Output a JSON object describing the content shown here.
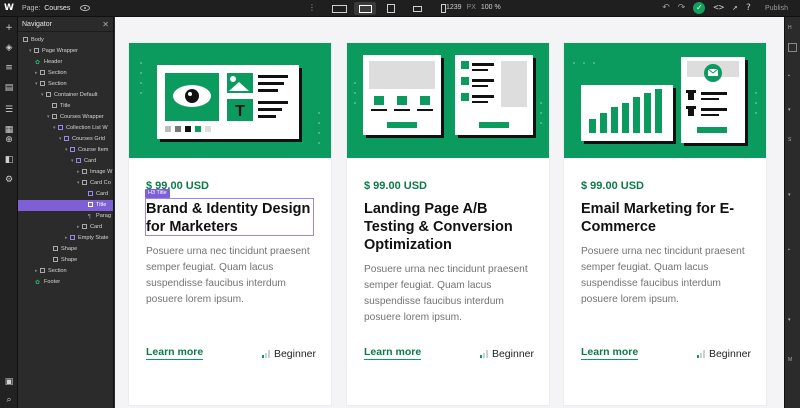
{
  "topbar": {
    "page_label": "Page:",
    "page_name": "Courses",
    "width_value": "1239",
    "width_unit": "PX",
    "zoom": "100 %",
    "publish_label": "Publish"
  },
  "navigator": {
    "title": "Navigator",
    "nodes": [
      {
        "label": "Body"
      },
      {
        "label": "Page Wrapper"
      },
      {
        "label": "Header"
      },
      {
        "label": "Section"
      },
      {
        "label": "Section"
      },
      {
        "label": "Container Default"
      },
      {
        "label": "Title"
      },
      {
        "label": "Courses Wrapper"
      },
      {
        "label": "Collection List W"
      },
      {
        "label": "Courses Grid"
      },
      {
        "label": "Course Item"
      },
      {
        "label": "Card"
      },
      {
        "label": "Image W"
      },
      {
        "label": "Card Co"
      },
      {
        "label": "Card"
      },
      {
        "label": "Title"
      },
      {
        "label": "Parag"
      },
      {
        "label": "Card"
      },
      {
        "label": "Empty State"
      },
      {
        "label": "Shape"
      },
      {
        "label": "Shape"
      },
      {
        "label": "Section"
      },
      {
        "label": "Footer"
      }
    ]
  },
  "selection": {
    "tag": "H3 Title"
  },
  "cards": [
    {
      "price": "$ 99.00 USD",
      "title": "Brand & Identity Design for Marketers",
      "description": "Posuere urna nec tincidunt praesent semper feugiat. Quam lacus suspendisse faucibus interdum posuere lorem ipsum.",
      "link": "Learn more",
      "level": "Beginner",
      "level_bars_filled": 1
    },
    {
      "price": "$ 99.00 USD",
      "title": "Landing Page A/B Testing & Conversion Optimization",
      "description": "Posuere urna nec tincidunt praesent semper feugiat. Quam lacus suspendisse faucibus interdum posuere lorem ipsum.",
      "link": "Learn more",
      "level": "Beginner",
      "level_bars_filled": 1
    },
    {
      "price": "$ 99.00 USD",
      "title": "Email Marketing for E-Commerce",
      "description": "Posuere urna nec tincidunt praesent semper feugiat. Quam lacus suspendisse faucibus interdum posuere lorem ipsum.",
      "link": "Learn more",
      "level": "Beginner",
      "level_bars_filled": 1
    }
  ],
  "colors": {
    "brand_green": "#0c9b5e",
    "selection_purple": "#7e5fd6",
    "publish_check": "#13a05a"
  }
}
